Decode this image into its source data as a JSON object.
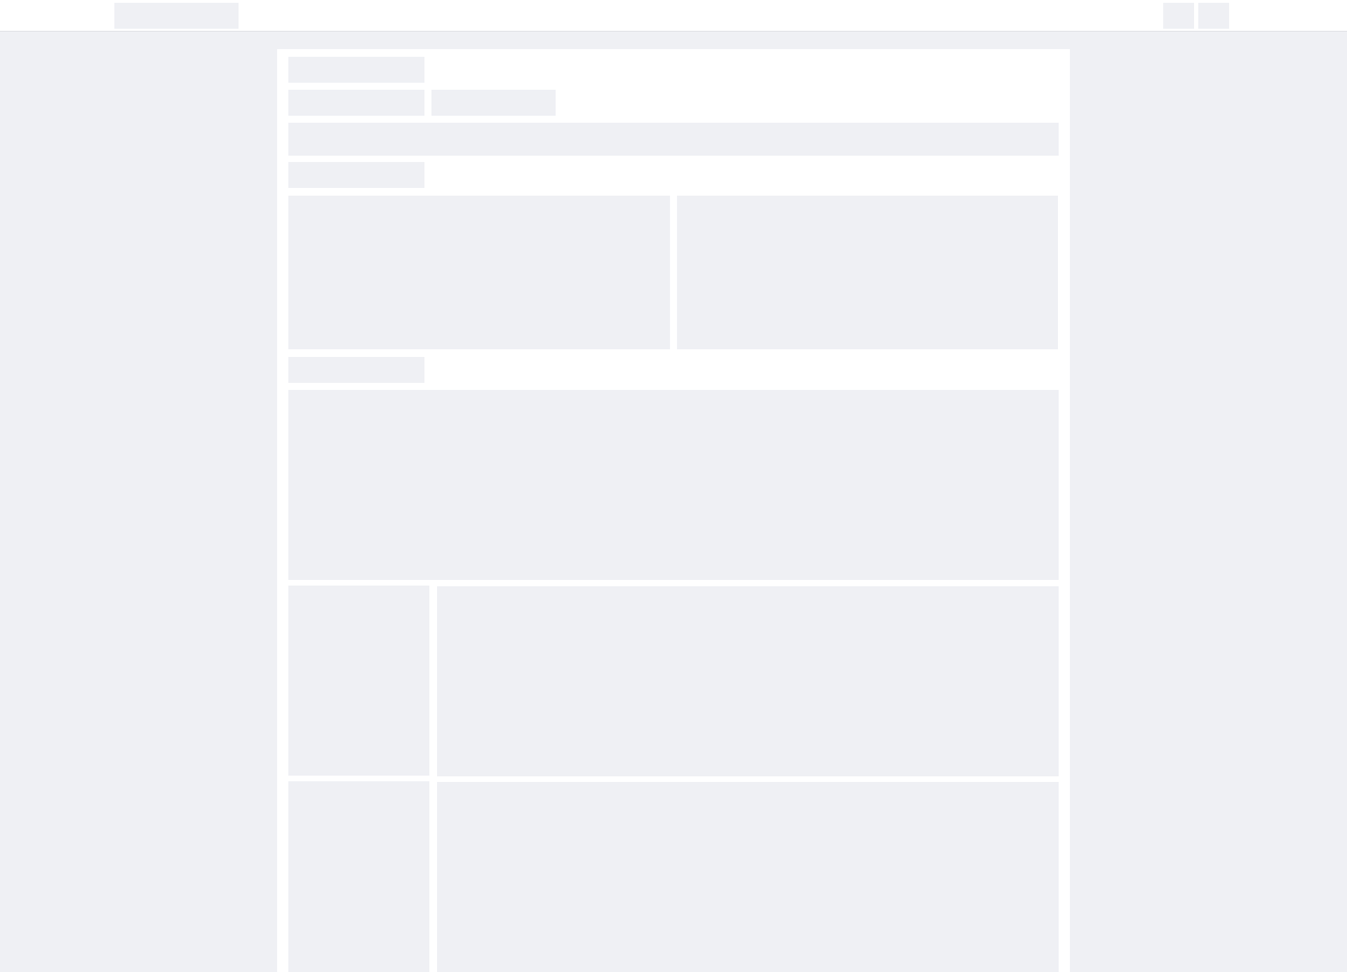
{
  "state": "loading",
  "colors": {
    "page_background": "#eff0f4",
    "surface": "#ffffff",
    "placeholder": "#eff0f4",
    "divider": "#dcdde2"
  },
  "header": {
    "logo": "",
    "actions": []
  },
  "content": {
    "title": "",
    "tabs": [],
    "sections": []
  }
}
